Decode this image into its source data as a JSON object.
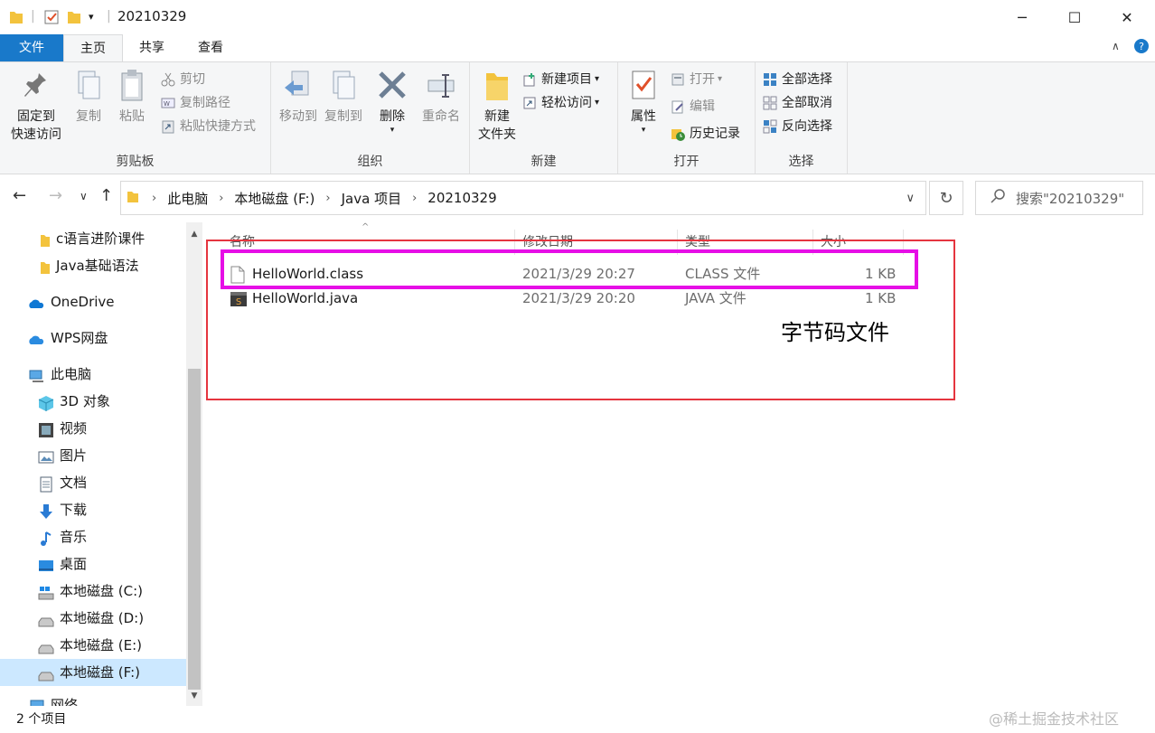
{
  "window": {
    "title": "20210329",
    "minimize_glyph": "─",
    "maximize_glyph": "☐",
    "close_glyph": "✕"
  },
  "tabs": {
    "file": "文件",
    "home": "主页",
    "share": "共享",
    "view": "查看"
  },
  "ribbon": {
    "clipboard": {
      "label": "剪贴板",
      "pin_line1": "固定到",
      "pin_line2": "快速访问",
      "copy": "复制",
      "paste": "粘贴",
      "cut": "剪切",
      "copy_path": "复制路径",
      "paste_shortcut": "粘贴快捷方式"
    },
    "organize": {
      "label": "组织",
      "move_to": "移动到",
      "copy_to": "复制到",
      "delete": "删除",
      "rename": "重命名"
    },
    "new": {
      "label": "新建",
      "new_folder_line1": "新建",
      "new_folder_line2": "文件夹",
      "new_item": "新建项目",
      "easy_access": "轻松访问"
    },
    "open": {
      "label": "打开",
      "properties": "属性",
      "open": "打开",
      "edit": "编辑",
      "history": "历史记录"
    },
    "select": {
      "label": "选择",
      "select_all": "全部选择",
      "select_none": "全部取消",
      "invert": "反向选择"
    }
  },
  "address": {
    "crumbs": [
      "此电脑",
      "本地磁盘 (F:)",
      "Java 项目",
      "20210329"
    ],
    "search_placeholder": "搜索\"20210329\""
  },
  "sidebar": {
    "items": [
      {
        "label": "c语言进阶课件",
        "icon": "folder-icon"
      },
      {
        "label": "Java基础语法",
        "icon": "folder-icon"
      },
      {
        "label": "OneDrive",
        "icon": "cloud-icon"
      },
      {
        "label": "WPS网盘",
        "icon": "cloud-icon"
      },
      {
        "label": "此电脑",
        "icon": "computer-icon"
      },
      {
        "label": "3D 对象",
        "icon": "cube-icon"
      },
      {
        "label": "视频",
        "icon": "video-icon"
      },
      {
        "label": "图片",
        "icon": "picture-icon"
      },
      {
        "label": "文档",
        "icon": "document-icon"
      },
      {
        "label": "下载",
        "icon": "download-icon"
      },
      {
        "label": "音乐",
        "icon": "music-icon"
      },
      {
        "label": "桌面",
        "icon": "desktop-icon"
      },
      {
        "label": "本地磁盘 (C:)",
        "icon": "drive-icon"
      },
      {
        "label": "本地磁盘 (D:)",
        "icon": "drive-icon"
      },
      {
        "label": "本地磁盘 (E:)",
        "icon": "drive-icon"
      },
      {
        "label": "本地磁盘 (F:)",
        "icon": "drive-icon"
      },
      {
        "label": "网络",
        "icon": "network-icon"
      }
    ]
  },
  "files": {
    "columns": [
      "名称",
      "修改日期",
      "类型",
      "大小"
    ],
    "rows": [
      {
        "name": "HelloWorld.class",
        "date": "2021/3/29 20:27",
        "type": "CLASS 文件",
        "size": "1 KB"
      },
      {
        "name": "HelloWorld.java",
        "date": "2021/3/29 20:20",
        "type": "JAVA 文件",
        "size": "1 KB"
      }
    ]
  },
  "annotation": "字节码文件",
  "status": {
    "count": "2 个项目"
  },
  "watermark": "@稀土掘金技术社区",
  "colors": {
    "accent": "#1979ca",
    "highlight_pink": "#e60ee6",
    "highlight_red": "#e5353f",
    "selected_bg": "#cce8ff"
  }
}
